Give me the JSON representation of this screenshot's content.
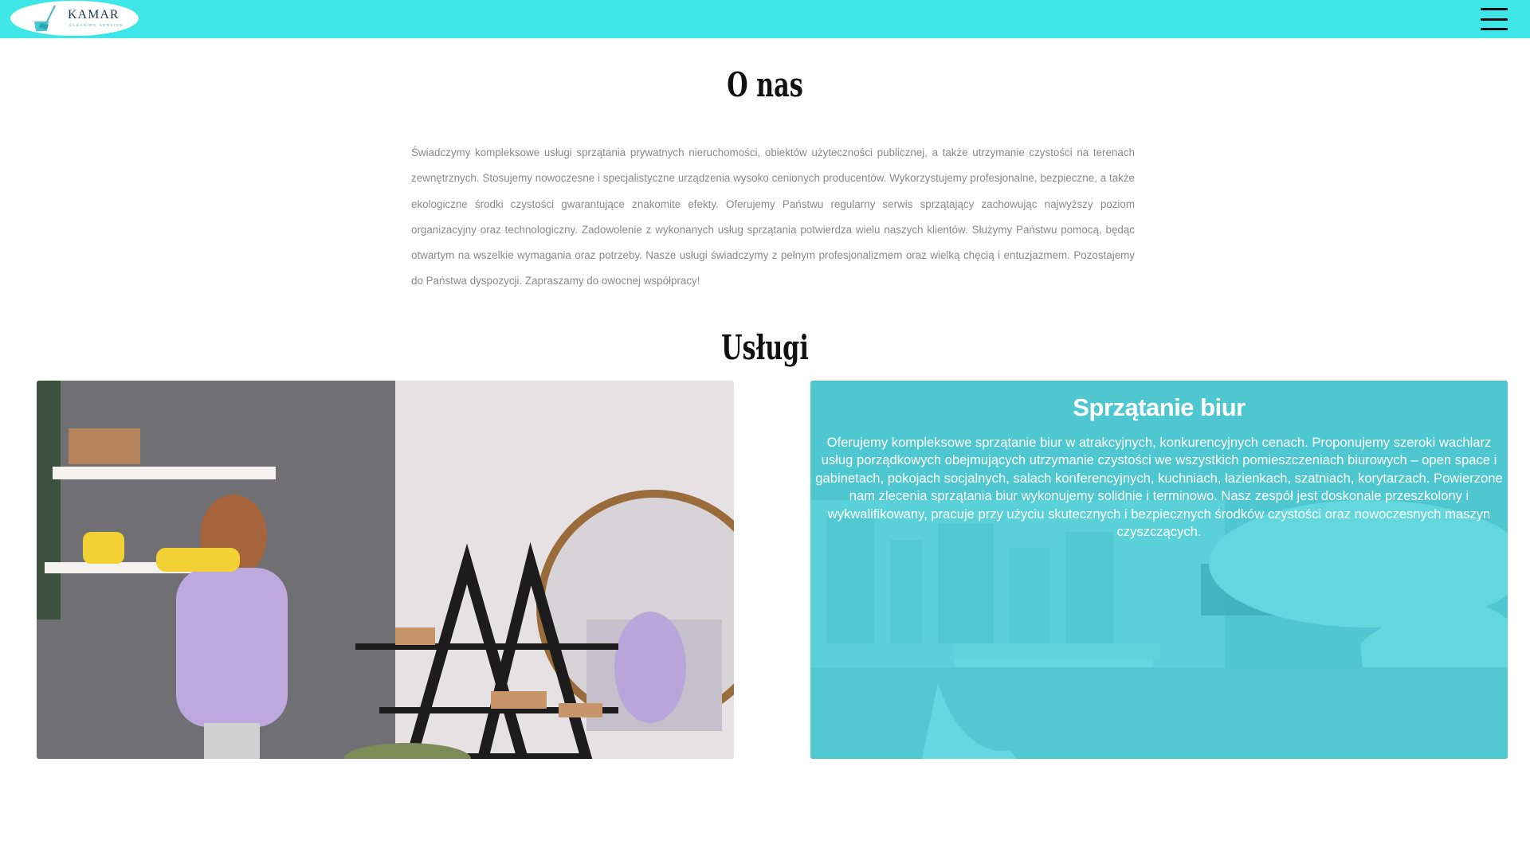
{
  "header": {
    "logo_text": "KAMAR",
    "logo_subtext": "cleaning service",
    "logo_icon": "broom-bucket-icon",
    "menu_icon": "hamburger-menu-icon",
    "bar_color": "#3fe6e8"
  },
  "about": {
    "title": "O nas",
    "text": "Świadczymy kompleksowe usługi sprzątania prywatnych nieruchomości, obiektów użyteczności publicznej, a także utrzymanie czystości na terenach zewnętrznych. Stosujemy nowoczesne i specjalistyczne urządzenia wysoko cenionych producentów. Wykorzystujemy profesjonalne, bezpieczne, a także ekologiczne środki czystości gwarantujące znakomite efekty. Oferujemy Państwu regularny serwis sprzątający zachowując najwyższy poziom organizacyjny oraz technologiczny. Zadowolenie z wykonanych usług sprzątania potwierdza wielu naszych klientów. Służymy Państwu pomocą, będąc otwartym na wszelkie wymagania oraz potrzeby. Nasze usługi świadczymy z pełnym profesjonalizmem oraz wielką chęcią i entuzjazmem. Pozostajemy do Państwa dyspozycji. Zapraszamy do owocnej współpracy!"
  },
  "services": {
    "title": "Usługi",
    "cards": [
      {
        "title": "Sprzątanie biur",
        "description": "Oferujemy kompleksowe sprzątanie biur w atrakcyjnych, konkurencyjnych cenach. Proponujemy szeroki wachlarz usług porządkowych obejmujących utrzymanie czystości we wszystkich pomieszczeniach biurowych – open space i gabinetach, pokojach socjalnych, salach konferencyjnych, kuchniach, łazienkach, szatniach, korytarzach. Powierzone nam zlecenia sprzątania biur wykonujemy solidnie i terminowo. Nasz zespół jest doskonale przeszkolony i wykwalifikowany, pracuje przy użyciu skutecznych i bezpiecznych środków czystości oraz nowoczesnych maszyn czyszczących.",
        "overlay_color": "#40d2da"
      }
    ]
  }
}
